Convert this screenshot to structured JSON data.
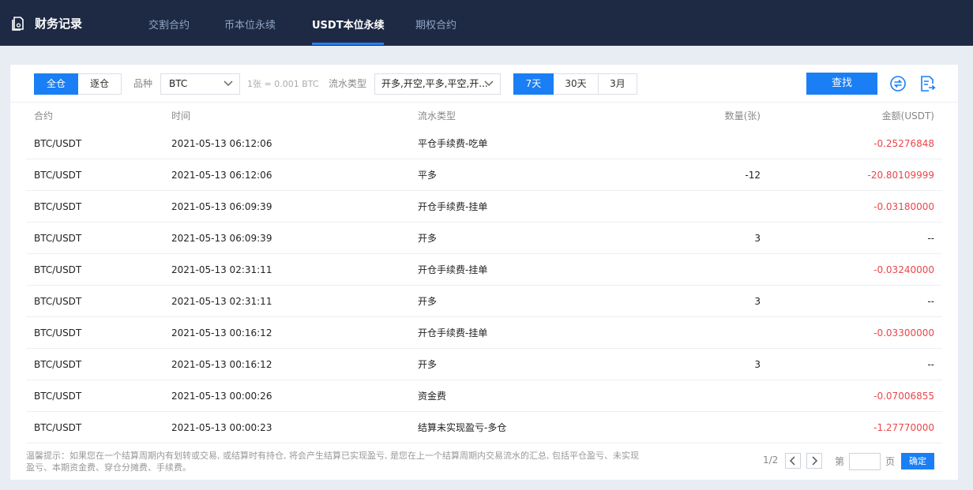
{
  "header": {
    "title": "财务记录",
    "tabs": [
      {
        "label": "交割合约"
      },
      {
        "label": "币本位永续"
      },
      {
        "label": "USDT本位永续"
      },
      {
        "label": "期权合约"
      }
    ],
    "active_tab": "USDT本位永续"
  },
  "filters": {
    "position_mode": {
      "options": [
        "全仓",
        "逐仓"
      ],
      "selected": "全仓"
    },
    "symbol_label": "品种",
    "symbol_value": "BTC",
    "contract_size_hint": "1张 = 0.001 BTC",
    "flow_type_label": "流水类型",
    "flow_type_value": "开多,开空,平多,平空,开...",
    "range": {
      "options": [
        "7天",
        "30天",
        "3月"
      ],
      "selected": "7天"
    },
    "search_label": "查找",
    "icons": [
      "swap-icon",
      "export-icon"
    ]
  },
  "table": {
    "columns": [
      "合约",
      "时间",
      "流水类型",
      "数量(张)",
      "金额(USDT)"
    ],
    "rows": [
      [
        "BTC/USDT",
        "2021-05-13 06:12:06",
        "平仓手续费-吃单",
        "",
        "-0.25276848"
      ],
      [
        "BTC/USDT",
        "2021-05-13 06:12:06",
        "平多",
        "-12",
        "-20.80109999"
      ],
      [
        "BTC/USDT",
        "2021-05-13 06:09:39",
        "开仓手续费-挂单",
        "",
        "-0.03180000"
      ],
      [
        "BTC/USDT",
        "2021-05-13 06:09:39",
        "开多",
        "3",
        "--"
      ],
      [
        "BTC/USDT",
        "2021-05-13 02:31:11",
        "开仓手续费-挂单",
        "",
        "-0.03240000"
      ],
      [
        "BTC/USDT",
        "2021-05-13 02:31:11",
        "开多",
        "3",
        "--"
      ],
      [
        "BTC/USDT",
        "2021-05-13 00:16:12",
        "开仓手续费-挂单",
        "",
        "-0.03300000"
      ],
      [
        "BTC/USDT",
        "2021-05-13 00:16:12",
        "开多",
        "3",
        "--"
      ],
      [
        "BTC/USDT",
        "2021-05-13 00:00:26",
        "资金费",
        "",
        "-0.07006855"
      ],
      [
        "BTC/USDT",
        "2021-05-13 00:00:23",
        "结算未实现盈亏-多仓",
        "",
        "-1.27770000"
      ]
    ]
  },
  "footer": {
    "note_line1": "温馨提示：如果您在一个结算周期内有划转或交易, 或结算时有持仓, 将会产生结算已实现盈亏, 是您在上一个结算周期内交易流水的汇总, 包括平仓盈亏、未实现",
    "note_line2": "盈亏、本期资金费、穿仓分摊费、手续费。",
    "page_indicator": "1/2",
    "goto_prefix": "第",
    "goto_suffix": "页",
    "confirm_label": "确定"
  },
  "colors": {
    "nav_bg": "#1e2a44",
    "accent": "#1a7ff5",
    "negative": "#e8474b"
  }
}
